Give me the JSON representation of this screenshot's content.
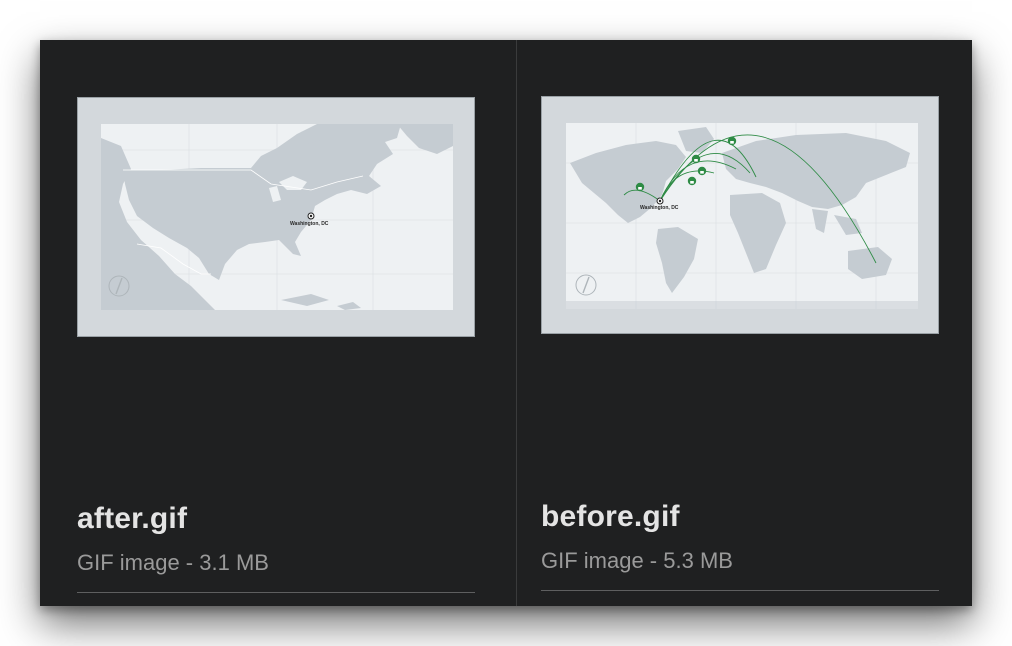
{
  "files": [
    {
      "name": "after.gif",
      "info": "GIF image - 3.1 MB",
      "preview": {
        "map_label": "Washington, DC",
        "icons": [
          "compass-icon",
          "location-pin-icon"
        ]
      }
    },
    {
      "name": "before.gif",
      "info": "GIF image - 5.3 MB",
      "preview": {
        "map_label": "Washington, DC",
        "icons": [
          "compass-icon",
          "location-pin-icon",
          "lock-icon"
        ]
      }
    }
  ],
  "colors": {
    "window_bg": "#1f2021",
    "thumb_frame": "#d3d8dc",
    "map_bg": "#eef1f3",
    "land": "#c5ccd2",
    "route": "#2e8b45",
    "title_text": "#e4e4e4",
    "subtitle_text": "#9a9a9a"
  }
}
